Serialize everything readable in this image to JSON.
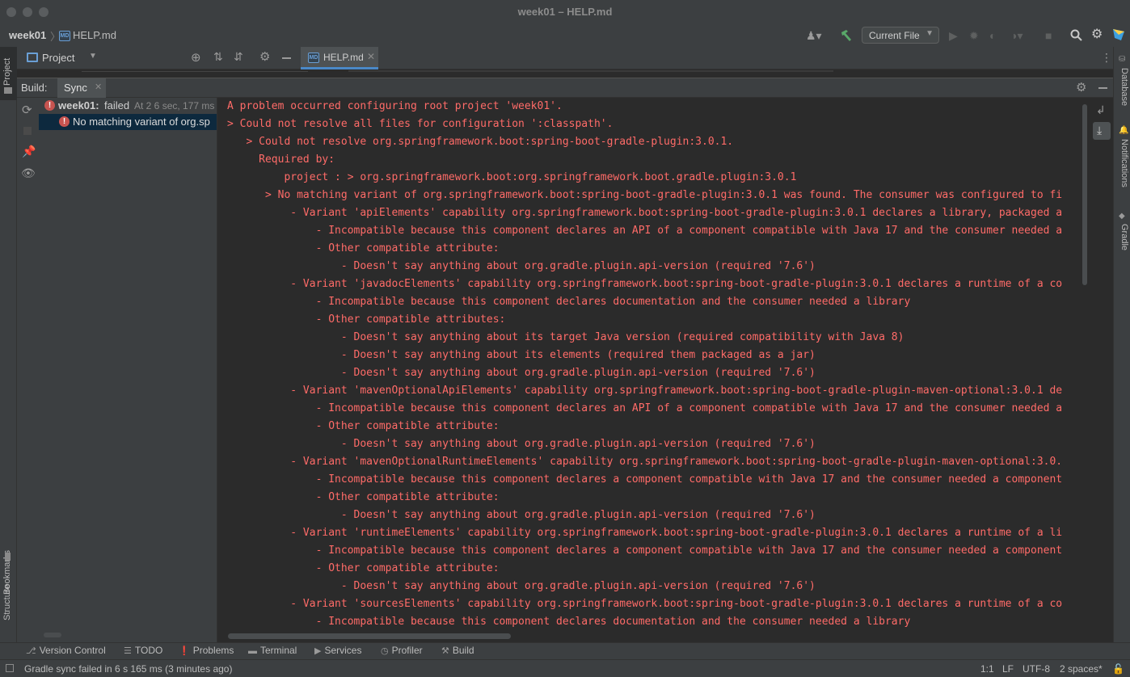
{
  "window": {
    "title": "week01 – HELP.md"
  },
  "navbar": {
    "project": "week01",
    "file": "HELP.md",
    "file_icon": "MD",
    "run_config": "Current File"
  },
  "project_panel": {
    "title": "Project"
  },
  "editor": {
    "tabs": [
      {
        "label": "HELP.md",
        "active": true
      }
    ]
  },
  "left_strip": {
    "project": "Project",
    "bookmarks": "Bookmarks",
    "structure": "Structure"
  },
  "right_strip": {
    "database": "Database",
    "notifications": "Notifications",
    "gradle": "Gradle"
  },
  "build": {
    "title": "Build:",
    "tab": "Sync",
    "tree": [
      {
        "status": "failed",
        "label": "week01:",
        "result": "failed",
        "meta": "At 2 6 sec, 177 ms"
      },
      {
        "status": "error",
        "label": "No matching variant of org.sp"
      }
    ],
    "log": [
      "A problem occurred configuring root project 'week01'.",
      "> Could not resolve all files for configuration ':classpath'.",
      "   > Could not resolve org.springframework.boot:spring-boot-gradle-plugin:3.0.1.",
      "     Required by:",
      "         project : > org.springframework.boot:org.springframework.boot.gradle.plugin:3.0.1",
      "      > No matching variant of org.springframework.boot:spring-boot-gradle-plugin:3.0.1 was found. The consumer was configured to fi",
      "          - Variant 'apiElements' capability org.springframework.boot:spring-boot-gradle-plugin:3.0.1 declares a library, packaged a",
      "              - Incompatible because this component declares an API of a component compatible with Java 17 and the consumer needed a",
      "              - Other compatible attribute:",
      "                  - Doesn't say anything about org.gradle.plugin.api-version (required '7.6')",
      "          - Variant 'javadocElements' capability org.springframework.boot:spring-boot-gradle-plugin:3.0.1 declares a runtime of a co",
      "              - Incompatible because this component declares documentation and the consumer needed a library",
      "              - Other compatible attributes:",
      "                  - Doesn't say anything about its target Java version (required compatibility with Java 8)",
      "                  - Doesn't say anything about its elements (required them packaged as a jar)",
      "                  - Doesn't say anything about org.gradle.plugin.api-version (required '7.6')",
      "          - Variant 'mavenOptionalApiElements' capability org.springframework.boot:spring-boot-gradle-plugin-maven-optional:3.0.1 de",
      "              - Incompatible because this component declares an API of a component compatible with Java 17 and the consumer needed a",
      "              - Other compatible attribute:",
      "                  - Doesn't say anything about org.gradle.plugin.api-version (required '7.6')",
      "          - Variant 'mavenOptionalRuntimeElements' capability org.springframework.boot:spring-boot-gradle-plugin-maven-optional:3.0.",
      "              - Incompatible because this component declares a component compatible with Java 17 and the consumer needed a component",
      "              - Other compatible attribute:",
      "                  - Doesn't say anything about org.gradle.plugin.api-version (required '7.6')",
      "          - Variant 'runtimeElements' capability org.springframework.boot:spring-boot-gradle-plugin:3.0.1 declares a runtime of a li",
      "              - Incompatible because this component declares a component compatible with Java 17 and the consumer needed a component",
      "              - Other compatible attribute:",
      "                  - Doesn't say anything about org.gradle.plugin.api-version (required '7.6')",
      "          - Variant 'sourcesElements' capability org.springframework.boot:spring-boot-gradle-plugin:3.0.1 declares a runtime of a co",
      "              - Incompatible because this component declares documentation and the consumer needed a library"
    ]
  },
  "bottom_tools": [
    {
      "label": "Version Control",
      "icon": "vcs-icon"
    },
    {
      "label": "TODO",
      "icon": "todo-icon"
    },
    {
      "label": "Problems",
      "icon": "problems-icon"
    },
    {
      "label": "Terminal",
      "icon": "terminal-icon"
    },
    {
      "label": "Services",
      "icon": "services-icon"
    },
    {
      "label": "Profiler",
      "icon": "profiler-icon"
    },
    {
      "label": "Build",
      "icon": "hammer-icon"
    }
  ],
  "status": {
    "message": "Gradle sync failed in 6 s 165 ms (3 minutes ago)",
    "position": "1:1",
    "line_sep": "LF",
    "encoding": "UTF-8",
    "indent": "2 spaces*"
  },
  "colors": {
    "error": "#ff6b68",
    "background": "#2b2b2b",
    "panel": "#3c3f41",
    "accent": "#4a88c7"
  }
}
